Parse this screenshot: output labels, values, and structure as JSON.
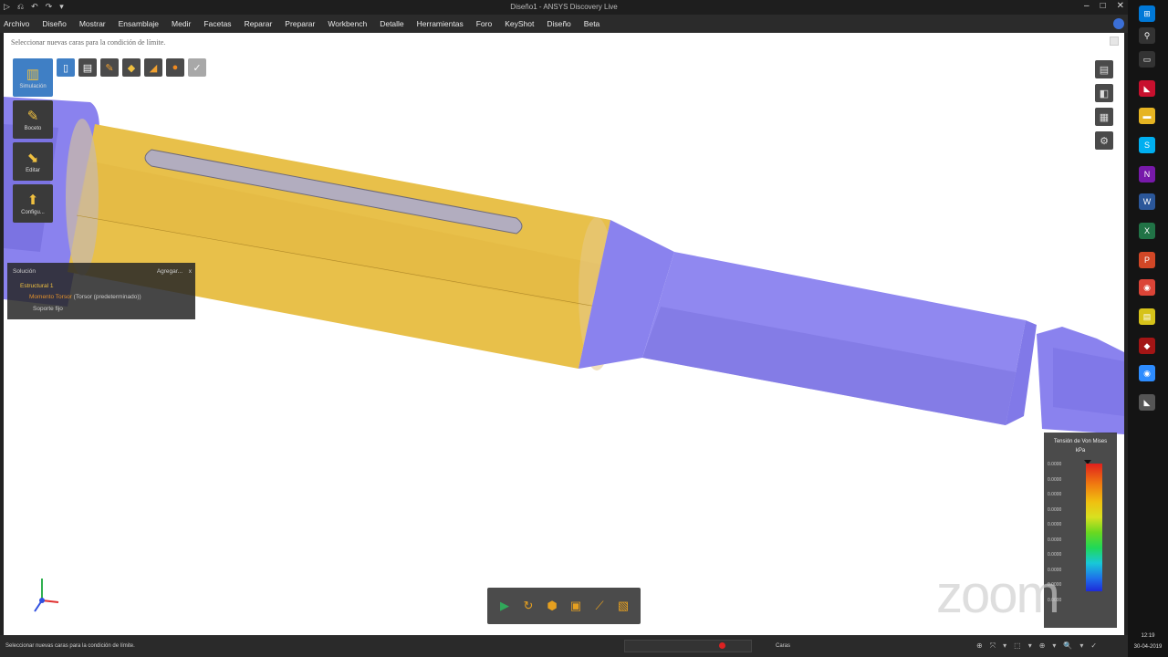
{
  "window": {
    "title": "Diseño1 - ANSYS Discovery Live",
    "quick_access": [
      "▷",
      "⎌",
      "↶",
      "↷",
      "▾"
    ],
    "controls": [
      "–",
      "□",
      "✕"
    ]
  },
  "menu": {
    "items": [
      "Archivo",
      "Diseño",
      "Mostrar",
      "Ensamblaje",
      "Medir",
      "Facetas",
      "Reparar",
      "Preparar",
      "Workbench",
      "Detalle",
      "Herramientas",
      "Foro",
      "KeyShot",
      "Diseño",
      "Beta"
    ]
  },
  "viewport": {
    "hint": "Seleccionar nuevas caras para la condición de límite."
  },
  "left_tools": [
    {
      "label": "Simulación",
      "icon": "beaker-icon",
      "glyph": "▥",
      "active": true
    },
    {
      "label": "Boceto",
      "icon": "pencil-icon",
      "glyph": "✎",
      "active": false
    },
    {
      "label": "Editar",
      "icon": "edit-icon",
      "glyph": "⬊",
      "active": false
    },
    {
      "label": "Configu...",
      "icon": "setup-icon",
      "glyph": "⬆",
      "active": false
    }
  ],
  "top_toolbar": [
    {
      "icon": "column-select-icon",
      "glyph": "▯",
      "color": "#3f7fc5"
    },
    {
      "icon": "structure-icon",
      "glyph": "▤",
      "color": "#4a4a4a"
    },
    {
      "icon": "paint-icon",
      "glyph": "✎",
      "color": "#4a4a4a"
    },
    {
      "icon": "fluid-icon",
      "glyph": "◆",
      "color": "#4a4a4a"
    },
    {
      "icon": "thermal-icon",
      "glyph": "◢",
      "color": "#4a4a4a"
    },
    {
      "icon": "material-icon",
      "glyph": "●",
      "color": "#4a4a4a"
    },
    {
      "icon": "check-icon",
      "glyph": "✓",
      "color": "#a8a8a8"
    }
  ],
  "tree_panel": {
    "header": "Solución",
    "add_label": "Agregar...",
    "close": "x",
    "root": "Estructural 1",
    "force_label": "Momento Torsor",
    "force_desc": "(Torsor (predeterminado))",
    "support": "Soporte fijo"
  },
  "right_buttons": [
    {
      "icon": "layers-icon",
      "glyph": "▤"
    },
    {
      "icon": "view-icon",
      "glyph": "◧"
    },
    {
      "icon": "grid-icon",
      "glyph": "▦"
    },
    {
      "icon": "settings-icon",
      "glyph": "⚙"
    }
  ],
  "legend": {
    "title": "Tensión de Von Mises",
    "unit": "kPa",
    "ticks": [
      "0.0000",
      "0.0000",
      "0.0000",
      "0.0000",
      "0.0000",
      "0.0000",
      "0.0000",
      "0.0000",
      "0.0000",
      "0.0000"
    ]
  },
  "mini_toolbar": [
    {
      "icon": "play-icon",
      "glyph": "▶"
    },
    {
      "icon": "rotate-icon",
      "glyph": "↻"
    },
    {
      "icon": "cube-icon",
      "glyph": "⬢"
    },
    {
      "icon": "frame-icon",
      "glyph": "▣"
    },
    {
      "icon": "probe-icon",
      "glyph": "⟋"
    },
    {
      "icon": "crop-icon",
      "glyph": "▧"
    }
  ],
  "watermark": "zoom",
  "status": {
    "message": "Seleccionar nuevas caras para la condición de límite.",
    "caras": "Caras",
    "tools": [
      "⊕",
      "⤧",
      "▾",
      "⬚",
      "▾",
      "⊕",
      "▾",
      "🔍",
      "▾",
      "✓"
    ]
  },
  "taskbar": {
    "icons": [
      {
        "icon": "windows-icon",
        "glyph": "⊞",
        "color": "#0078d7"
      },
      {
        "icon": "search-icon",
        "glyph": "⚲",
        "color": "#333"
      },
      {
        "icon": "task-view-icon",
        "glyph": "▭",
        "color": "#333"
      },
      {
        "icon": "ansys-icon",
        "glyph": "◣",
        "color": "#c8102e"
      },
      {
        "icon": "folder-icon",
        "glyph": "▬",
        "color": "#e6b422"
      },
      {
        "icon": "skype-icon",
        "glyph": "S",
        "color": "#00aff0"
      },
      {
        "icon": "onenote-icon",
        "glyph": "N",
        "color": "#7719aa"
      },
      {
        "icon": "word-icon",
        "glyph": "W",
        "color": "#2b579a"
      },
      {
        "icon": "excel-icon",
        "glyph": "X",
        "color": "#217346"
      },
      {
        "icon": "powerpoint-icon",
        "glyph": "P",
        "color": "#d24726"
      },
      {
        "icon": "chrome-icon",
        "glyph": "◉",
        "color": "#db4437"
      },
      {
        "icon": "notes-icon",
        "glyph": "▤",
        "color": "#d6c21a"
      },
      {
        "icon": "app-red-icon",
        "glyph": "◆",
        "color": "#a31515"
      },
      {
        "icon": "zoom-app-icon",
        "glyph": "◉",
        "color": "#2d8cff"
      },
      {
        "icon": "discovery-icon",
        "glyph": "◣",
        "color": "#555"
      }
    ],
    "time": "12:19",
    "date": "30-04-2019"
  },
  "colors": {
    "model_yellow": "#e8c04a",
    "model_purple": "#8a82ee"
  }
}
